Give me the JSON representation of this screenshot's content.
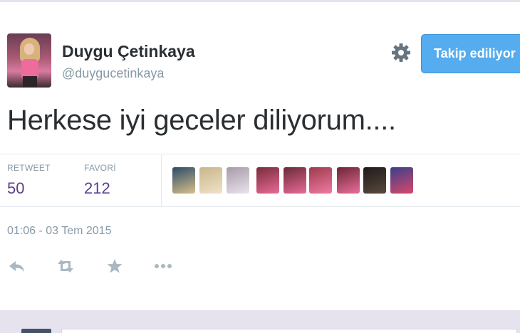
{
  "profile": {
    "display_name": "Duygu Çetinkaya",
    "screen_name": "@duygucetinkaya"
  },
  "follow_button": {
    "label": "Takip ediliyor"
  },
  "tweet": {
    "text": "Herkese iyi geceler diliyorum...."
  },
  "stats": {
    "retweets": {
      "label": "RETWEET",
      "value": "50"
    },
    "favorites": {
      "label": "FAVORİ",
      "value": "212"
    }
  },
  "favorited_by": [
    {
      "colors": [
        "#2b4a6a",
        "#d8c089"
      ]
    },
    {
      "colors": [
        "#c9b58c",
        "#f0e2c8"
      ]
    },
    {
      "colors": [
        "#a79aa8",
        "#e9e4ec"
      ]
    },
    {
      "colors": [
        "#7a2b3a",
        "#e86b98"
      ]
    },
    {
      "colors": [
        "#6a2a36",
        "#e86b98"
      ]
    },
    {
      "colors": [
        "#9c3a4e",
        "#f07aa3"
      ]
    },
    {
      "colors": [
        "#6b2536",
        "#ea6e9a"
      ]
    },
    {
      "colors": [
        "#1e1a1c",
        "#5a4a3c"
      ]
    },
    {
      "colors": [
        "#3b3f8a",
        "#d9486a"
      ]
    }
  ],
  "timestamp": "01:06 - 03 Tem 2015",
  "actions": [
    "reply-icon",
    "retweet-icon",
    "favorite-icon",
    "more-icon"
  ],
  "colors": {
    "accent": "#55acee",
    "stat_value": "#5b3d8f",
    "muted": "#8899a6"
  }
}
